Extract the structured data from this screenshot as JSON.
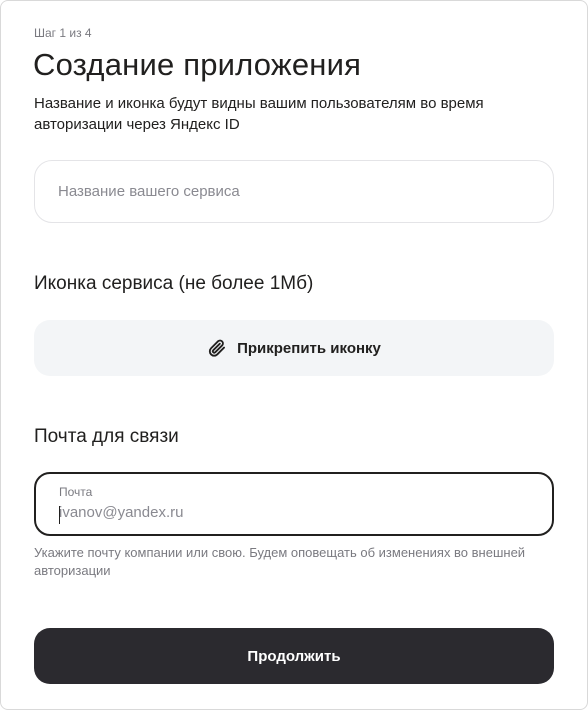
{
  "header": {
    "step": "Шаг 1 из 4",
    "title": "Создание приложения",
    "subtitle": "Название и иконка будут видны вашим пользователям во время авторизации через Яндекс ID"
  },
  "service_name": {
    "placeholder": "Название вашего сервиса",
    "value": ""
  },
  "icon_section": {
    "title": "Иконка сервиса (не более 1Мб)",
    "attach_label": "Прикрепить иконку",
    "attach_icon": "paperclip-icon"
  },
  "mail_section": {
    "title": "Почта для связи",
    "field_label": "Почта",
    "placeholder": "ivanov@yandex.ru",
    "value": "",
    "hint": "Укажите почту компании или свою. Будем оповещать об изменениях во внешней авторизации"
  },
  "actions": {
    "continue_label": "Продолжить"
  },
  "colors": {
    "primary_button": "#2b2a2f",
    "secondary_button": "#f3f5f7",
    "muted_text": "#7a7a80"
  }
}
